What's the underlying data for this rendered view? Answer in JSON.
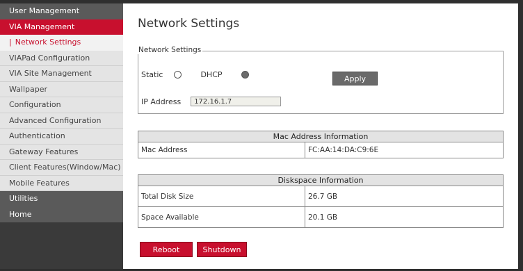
{
  "sidebar": {
    "items": [
      {
        "label": "User Management",
        "kind": "section"
      },
      {
        "label": "VIA Management",
        "kind": "active"
      },
      {
        "label": "Network Settings",
        "kind": "sub"
      },
      {
        "label": "VIAPad Configuration",
        "kind": "item"
      },
      {
        "label": "VIA Site Management",
        "kind": "item"
      },
      {
        "label": "Wallpaper",
        "kind": "item"
      },
      {
        "label": "Configuration",
        "kind": "item"
      },
      {
        "label": "Advanced Configuration",
        "kind": "item"
      },
      {
        "label": "Authentication",
        "kind": "item"
      },
      {
        "label": "Gateway Features",
        "kind": "item"
      },
      {
        "label": "Client Features(Window/Mac)",
        "kind": "item"
      },
      {
        "label": "Mobile Features",
        "kind": "item"
      },
      {
        "label": "Utilities",
        "kind": "section"
      },
      {
        "label": "Home",
        "kind": "section"
      }
    ],
    "sub_marker": "|"
  },
  "main": {
    "title": "Network Settings",
    "network": {
      "legend": "Network Settings",
      "static_label": "Static",
      "dhcp_label": "DHCP",
      "selected_mode": "DHCP",
      "apply_label": "Apply",
      "ip_label": "IP Address",
      "ip_value": "172.16.1.7"
    },
    "mac_table": {
      "header": "Mac Address Information",
      "rows": [
        {
          "label": "Mac Address",
          "value": "FC:AA:14:DA:C9:6E"
        }
      ]
    },
    "disk_table": {
      "header": "Diskspace Information",
      "rows": [
        {
          "label": "Total Disk Size",
          "value": "26.7 GB"
        },
        {
          "label": "Space Available",
          "value": "20.1 GB"
        }
      ]
    },
    "reboot_label": "Reboot",
    "shutdown_label": "Shutdown"
  },
  "colors": {
    "accent": "#c8102e",
    "sidebar_dark": "#3a3a3a",
    "section_gray": "#5a5a5a",
    "apply_gray": "#6a6a6a"
  }
}
